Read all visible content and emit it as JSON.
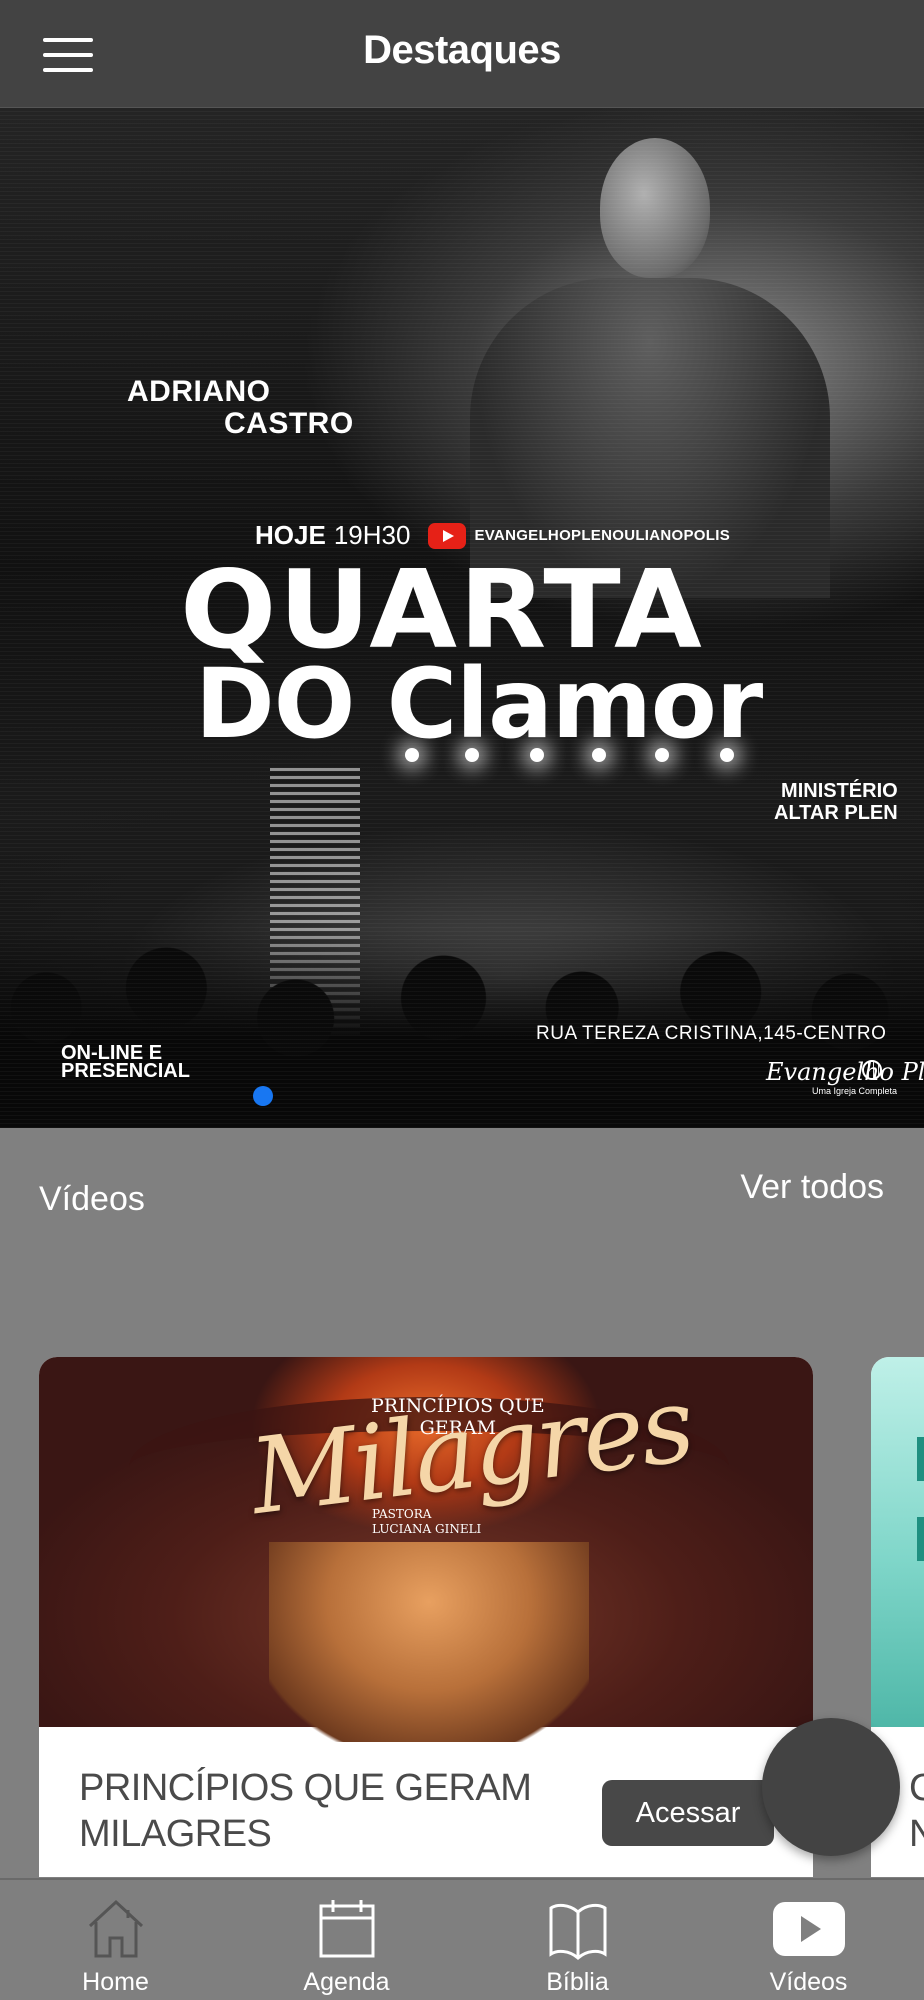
{
  "header": {
    "title": "Destaques"
  },
  "banner": {
    "speaker_name": [
      "ADRIANO",
      "CASTRO"
    ],
    "day_label": "HOJE",
    "time": "19H30",
    "channel": "EVANGELHOPLENOULIANOPOLIS",
    "headline_line1": "QUARTA",
    "headline_line2": "DO Clamor",
    "ministry": [
      "MINISTÉRIO",
      "ALTAR PLEN"
    ],
    "mode": [
      "ON-LINE E",
      "PRESENCIAL"
    ],
    "address": "RUA TEREZA CRISTINA,145-CENTRO",
    "church_logo": "Evangelho Pleno",
    "church_tagline": "Uma Igreja Completa",
    "active_page": 1
  },
  "videos": {
    "section_title": "Vídeos",
    "see_all_label": "Ver todos",
    "items": [
      {
        "title": "PRINCÍPIOS QUE GERAM MILAGRES",
        "action_label": "Acessar",
        "thumbnail_text": {
          "line1": [
            "PRINCÍPIOS QUE",
            "GERAM"
          ],
          "script": "Milagres",
          "byline": [
            "PASTORA",
            "LUCIANA GINELI"
          ]
        }
      },
      {
        "title_fragment": [
          "C",
          "N"
        ]
      }
    ]
  },
  "bottom_nav": {
    "items": [
      {
        "label": "Home",
        "icon": "home-icon"
      },
      {
        "label": "Agenda",
        "icon": "calendar-icon"
      },
      {
        "label": "Bíblia",
        "icon": "book-icon"
      },
      {
        "label": "Vídeos",
        "icon": "play-icon",
        "active": true
      }
    ]
  },
  "colors": {
    "appbar": "#434343",
    "background": "#808080",
    "page_dot": "#1877f2",
    "youtube_red": "#e62117",
    "button": "#484848"
  }
}
